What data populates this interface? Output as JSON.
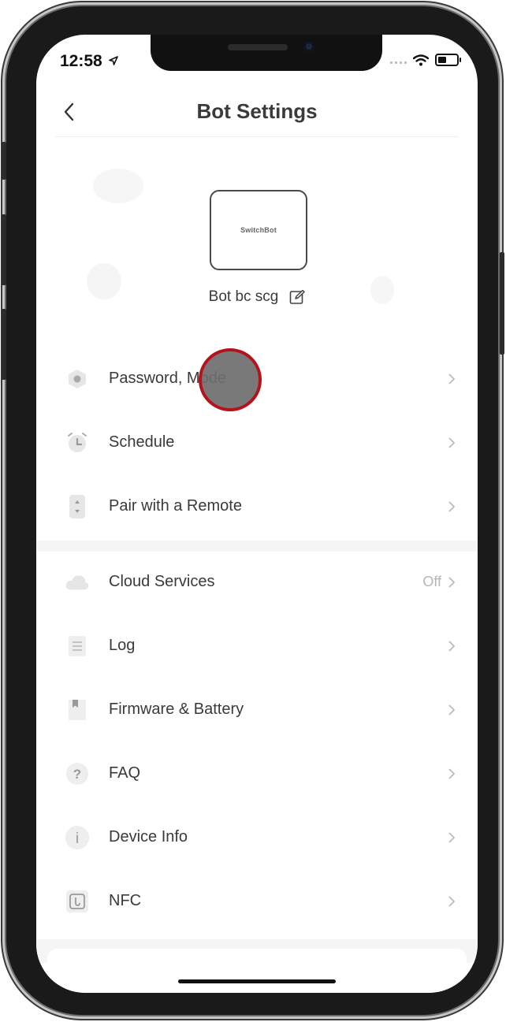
{
  "status_bar": {
    "time": "12:58"
  },
  "header": {
    "title": "Bot Settings"
  },
  "device": {
    "logo_text": "SwitchBot",
    "name": "Bot bc scg"
  },
  "section1": [
    {
      "key": "password-mode",
      "label": "Password, Mode",
      "icon": "hexagon-icon"
    },
    {
      "key": "schedule",
      "label": "Schedule",
      "icon": "alarm-clock-icon"
    },
    {
      "key": "pair-remote",
      "label": "Pair with a Remote",
      "icon": "remote-icon"
    }
  ],
  "section2": [
    {
      "key": "cloud-services",
      "label": "Cloud Services",
      "value": "Off",
      "icon": "cloud-icon"
    },
    {
      "key": "log",
      "label": "Log",
      "icon": "log-list-icon"
    },
    {
      "key": "firmware-battery",
      "label": "Firmware & Battery",
      "icon": "bookmark-icon"
    },
    {
      "key": "faq",
      "label": "FAQ",
      "icon": "question-icon"
    },
    {
      "key": "device-info",
      "label": "Device Info",
      "icon": "info-icon"
    },
    {
      "key": "nfc",
      "label": "NFC",
      "icon": "nfc-icon"
    }
  ]
}
